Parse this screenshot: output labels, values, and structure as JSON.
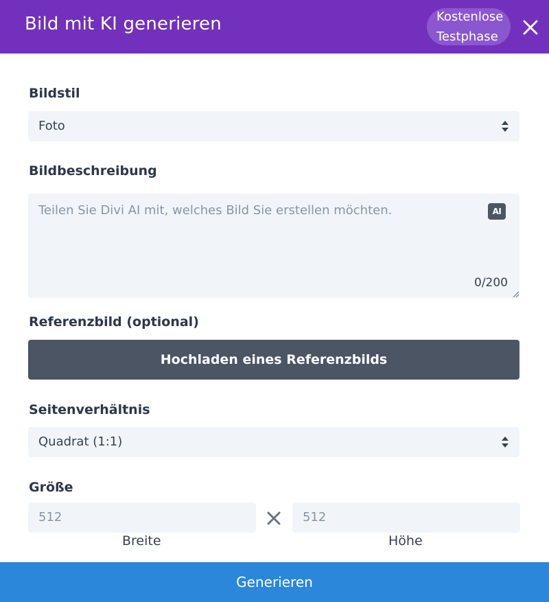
{
  "header": {
    "title": "Bild mit KI generieren",
    "trial_line1": "Kostenlose",
    "trial_line2": "Testphase",
    "close_icon": "close-icon"
  },
  "style": {
    "label": "Bildstil",
    "selected": "Foto"
  },
  "description": {
    "label": "Bildbeschreibung",
    "placeholder": "Teilen Sie Divi AI mit, welches Bild Sie erstellen möchten.",
    "ai_badge": "AI",
    "counter": "0/200"
  },
  "reference": {
    "label": "Referenzbild (optional)",
    "upload_label": "Hochladen eines Referenzbilds"
  },
  "aspect": {
    "label": "Seitenverhältnis",
    "selected": "Quadrat (1:1)"
  },
  "size": {
    "label": "Größe",
    "width_value": "512",
    "height_value": "512",
    "width_label": "Breite",
    "height_label": "Höhe"
  },
  "footer": {
    "generate_label": "Generieren"
  },
  "colors": {
    "header_bg": "#7230bd",
    "generate_bg": "#2b87da",
    "upload_bg": "#4b5563"
  }
}
